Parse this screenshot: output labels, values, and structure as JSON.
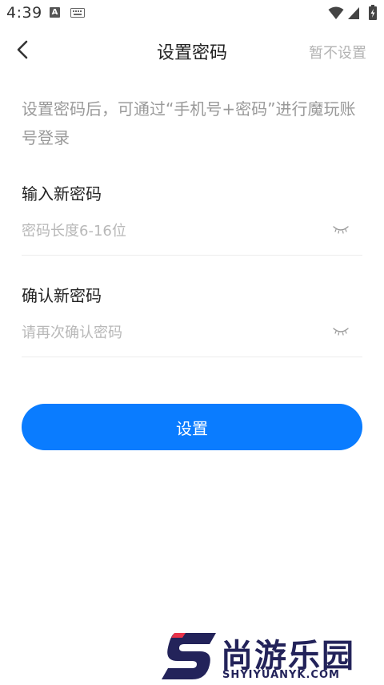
{
  "status_bar": {
    "time": "4:39",
    "notification_letter": "A",
    "icons": [
      "keyboard-icon",
      "wifi-icon",
      "signal-icon",
      "battery-icon"
    ]
  },
  "header": {
    "title": "设置密码",
    "skip_label": "暂不设置",
    "back_icon": "chevron-left-icon"
  },
  "hint_text": "设置密码后，可通过“手机号+密码”进行魔玩账号登录",
  "new_password": {
    "label": "输入新密码",
    "value": "",
    "placeholder": "密码长度6-16位",
    "toggle_icon": "eye-closed-icon"
  },
  "confirm_password": {
    "label": "确认新密码",
    "value": "",
    "placeholder": "请再次确认密码",
    "toggle_icon": "eye-closed-icon"
  },
  "submit_label": "设置",
  "watermark": {
    "title": "尚游乐园",
    "subtitle": "SHYIYUANYK.COM"
  },
  "colors": {
    "accent": "#0a7cff",
    "hint": "#9a9a9a",
    "placeholder": "#b8b8b8",
    "divider": "#ececec",
    "watermark": "#23235a",
    "watermark_accent": "#e8334a"
  }
}
